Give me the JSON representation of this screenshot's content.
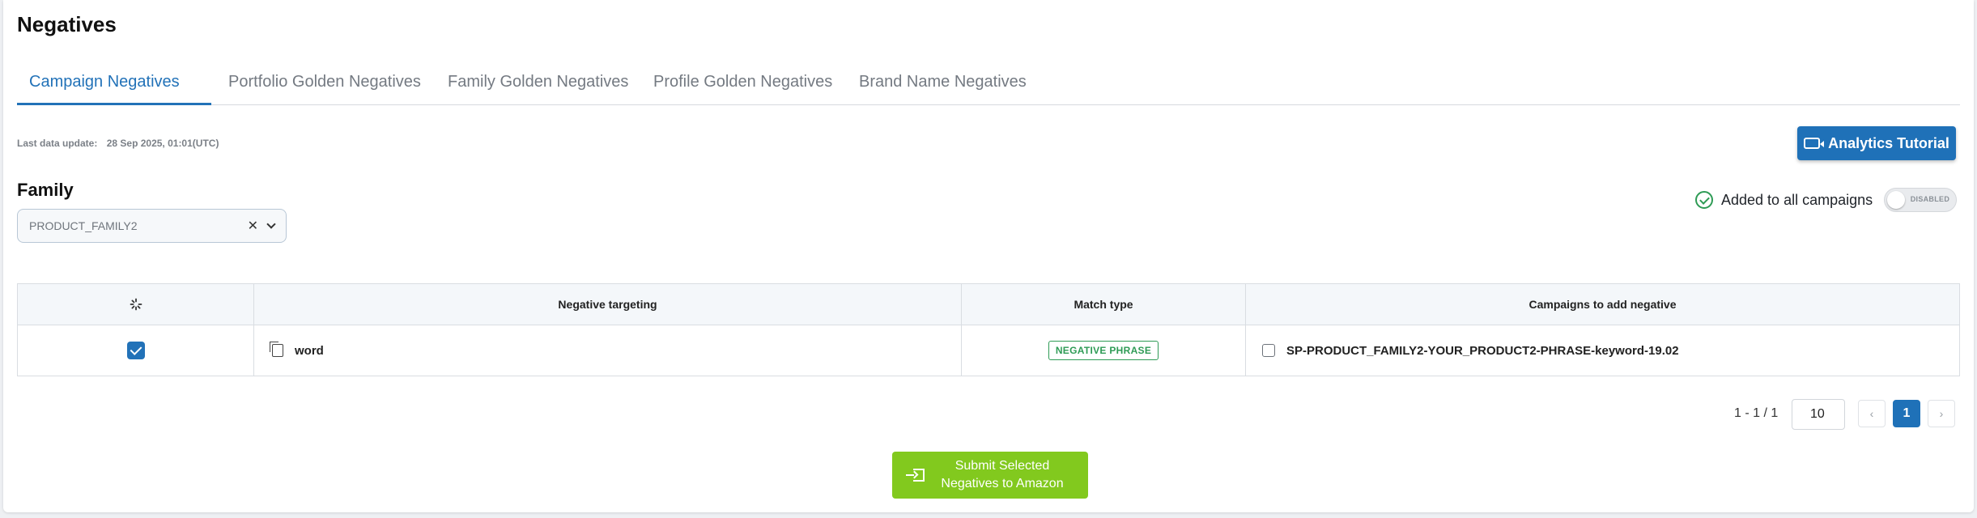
{
  "page": {
    "title": "Negatives"
  },
  "tabs": [
    {
      "label": "Campaign Negatives",
      "active": true
    },
    {
      "label": "Portfolio Golden Negatives",
      "active": false
    },
    {
      "label": "Family Golden Negatives",
      "active": false
    },
    {
      "label": "Profile Golden Negatives",
      "active": false
    },
    {
      "label": "Brand Name Negatives",
      "active": false
    }
  ],
  "last_update": {
    "label": "Last data update:",
    "value": "28 Sep 2025, 01:01(UTC)"
  },
  "tutorial_button": {
    "label": "Analytics Tutorial",
    "icon": "video-icon"
  },
  "family": {
    "label": "Family",
    "selected": "PRODUCT_FAMILY2",
    "clear": "✕"
  },
  "added_to_all": {
    "label": "Added to all campaigns",
    "toggle_state": "DISABLED"
  },
  "table": {
    "columns": [
      "",
      "Negative targeting",
      "Match type",
      "Campaigns to add negative"
    ],
    "rows": [
      {
        "selected": true,
        "negative_targeting": "word",
        "match_type": "NEGATIVE PHRASE",
        "campaign": "SP-PRODUCT_FAMILY2-YOUR_PRODUCT2-PHRASE-keyword-19.02"
      }
    ]
  },
  "pagination": {
    "info": "1 - 1 / 1",
    "page_size": "10",
    "prev": "‹",
    "current_page": "1",
    "next": "›"
  },
  "submit": {
    "label": "Submit Selected Negatives to Amazon"
  },
  "colors": {
    "accent": "#2272b8",
    "submit": "#82c91e",
    "success": "#2e9b55"
  }
}
